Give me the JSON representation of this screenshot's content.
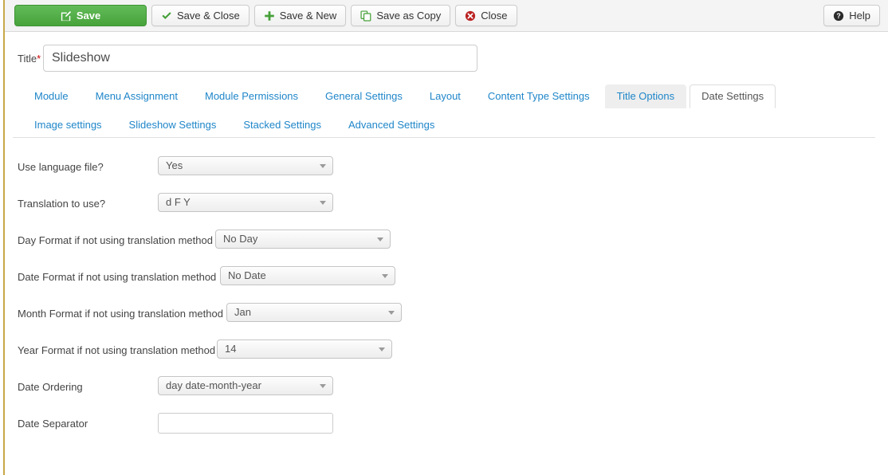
{
  "toolbar": {
    "buttons": [
      {
        "label": "Save",
        "icon": "edit-square-icon",
        "style": "primary"
      },
      {
        "label": "Save & Close",
        "icon": "check-icon",
        "style": "default"
      },
      {
        "label": "Save & New",
        "icon": "plus-icon",
        "style": "default"
      },
      {
        "label": "Save as Copy",
        "icon": "copy-icon",
        "style": "default"
      },
      {
        "label": "Close",
        "icon": "close-circle-icon",
        "style": "default"
      }
    ],
    "help": {
      "label": "Help",
      "icon": "help-circle-icon"
    }
  },
  "title_field": {
    "label": "Title",
    "required_mark": "*",
    "value": "Slideshow",
    "placeholder": ""
  },
  "tabs": [
    {
      "label": "Module",
      "state": "normal"
    },
    {
      "label": "Menu Assignment",
      "state": "normal"
    },
    {
      "label": "Module Permissions",
      "state": "normal"
    },
    {
      "label": "General Settings",
      "state": "normal"
    },
    {
      "label": "Layout",
      "state": "normal"
    },
    {
      "label": "Content Type Settings",
      "state": "normal"
    },
    {
      "label": "Title Options",
      "state": "hovered"
    },
    {
      "label": "Date Settings",
      "state": "active"
    },
    {
      "label": "Image settings",
      "state": "normal"
    },
    {
      "label": "Slideshow Settings",
      "state": "normal"
    },
    {
      "label": "Stacked Settings",
      "state": "normal"
    },
    {
      "label": "Advanced Settings",
      "state": "normal"
    }
  ],
  "fields": [
    {
      "label": "Use language file?",
      "type": "select",
      "value": "Yes"
    },
    {
      "label": "Translation to use?",
      "type": "select",
      "value": "d F Y"
    },
    {
      "label": "Day Format if not using translation method",
      "type": "select",
      "value": "No Day"
    },
    {
      "label": "Date Format if not using translation method",
      "type": "select",
      "value": "No Date"
    },
    {
      "label": "Month Format if not using translation method",
      "type": "select",
      "value": "Jan"
    },
    {
      "label": "Year Format if not using translation method",
      "type": "select",
      "value": "14"
    },
    {
      "label": "Date Ordering",
      "type": "select",
      "value": "day date-month-year"
    },
    {
      "label": "Date Separator",
      "type": "text",
      "value": "",
      "placeholder": ""
    }
  ],
  "colors": {
    "primary_green": "#47a33c",
    "link_blue": "#1f86c9",
    "required_red": "#cc0000",
    "rail_gold": "#c8a84b",
    "close_red": "#bb2222"
  }
}
